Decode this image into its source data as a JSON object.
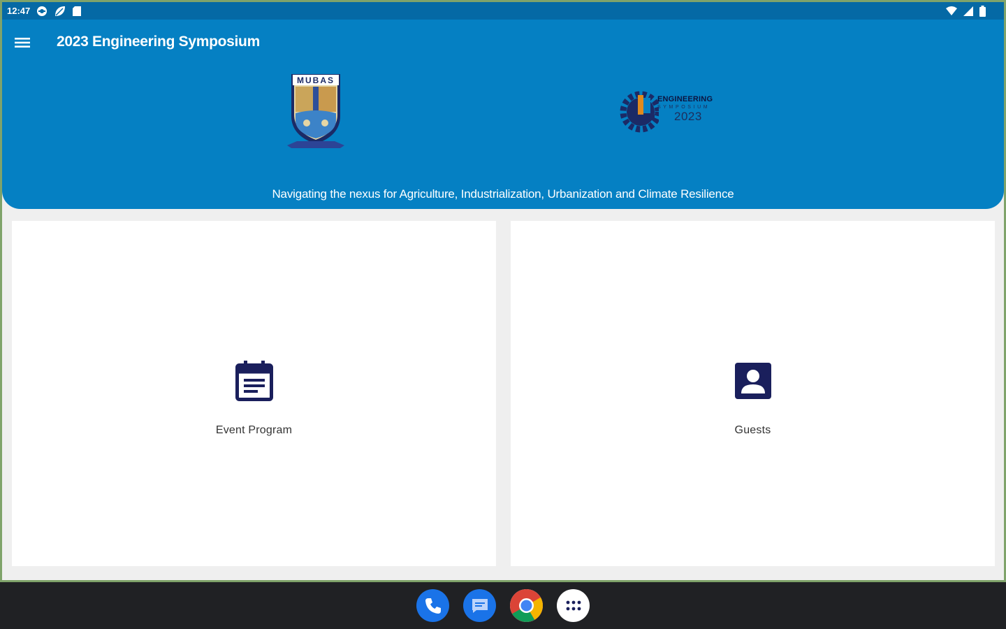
{
  "status_bar": {
    "time": "12:47",
    "left_icons": [
      "settings-icon",
      "leaf-icon",
      "sd-card-icon"
    ],
    "right_icons": [
      "wifi-icon",
      "signal-icon",
      "battery-icon"
    ]
  },
  "app_bar": {
    "title": "2023 Engineering Symposium",
    "menu_icon": "hamburger-icon"
  },
  "header": {
    "uni_logo_text": "MUBAS",
    "symposium_logo": {
      "title": "ENGINEERING",
      "subtitle": "SYMPOSIUM",
      "year": "2023"
    },
    "tagline": "Navigating the nexus for Agriculture, Industrialization, Urbanization and Climate Resilience"
  },
  "cards": [
    {
      "label": "Event Program",
      "icon": "calendar-icon"
    },
    {
      "label": "Guests",
      "icon": "person-icon"
    }
  ],
  "taskbar": {
    "apps": [
      "phone-icon",
      "messages-icon",
      "chrome-icon",
      "app-drawer-icon"
    ]
  },
  "colors": {
    "status_bar": "#0569a5",
    "header": "#0580c3",
    "icon_navy": "#1a1f5c",
    "taskbar": "#202124",
    "background": "#efefef"
  }
}
